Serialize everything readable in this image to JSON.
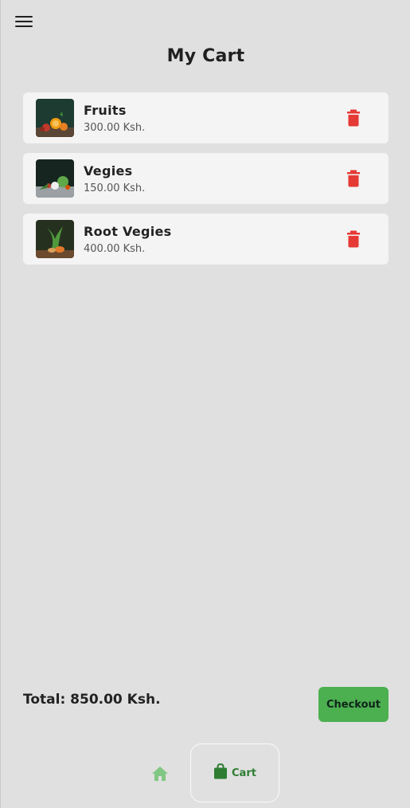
{
  "header": {
    "menu_icon": "hamburger-menu-icon",
    "title": "My Cart"
  },
  "cart": {
    "items": [
      {
        "name": "Fruits",
        "price": "300.00 Ksh.",
        "image": "fruits-thumbnail",
        "delete_icon": "trash-icon"
      },
      {
        "name": "Vegies",
        "price": "150.00 Ksh.",
        "image": "vegetables-thumbnail",
        "delete_icon": "trash-icon"
      },
      {
        "name": "Root Vegies",
        "price": "400.00 Ksh.",
        "image": "root-vegetables-thumbnail",
        "delete_icon": "trash-icon"
      }
    ]
  },
  "footer": {
    "total": "Total: 850.00 Ksh.",
    "checkout_label": "Checkout"
  },
  "bottom_nav": {
    "home_icon": "home-icon",
    "cart_icon": "shopping-bag-icon",
    "cart_label": "Cart"
  },
  "colors": {
    "background": "#e0e0e0",
    "card": "#f4f4f4",
    "delete": "#e53935",
    "accent_green": "#4caf50",
    "dark_green": "#2e7d32",
    "light_green": "#81c784"
  }
}
